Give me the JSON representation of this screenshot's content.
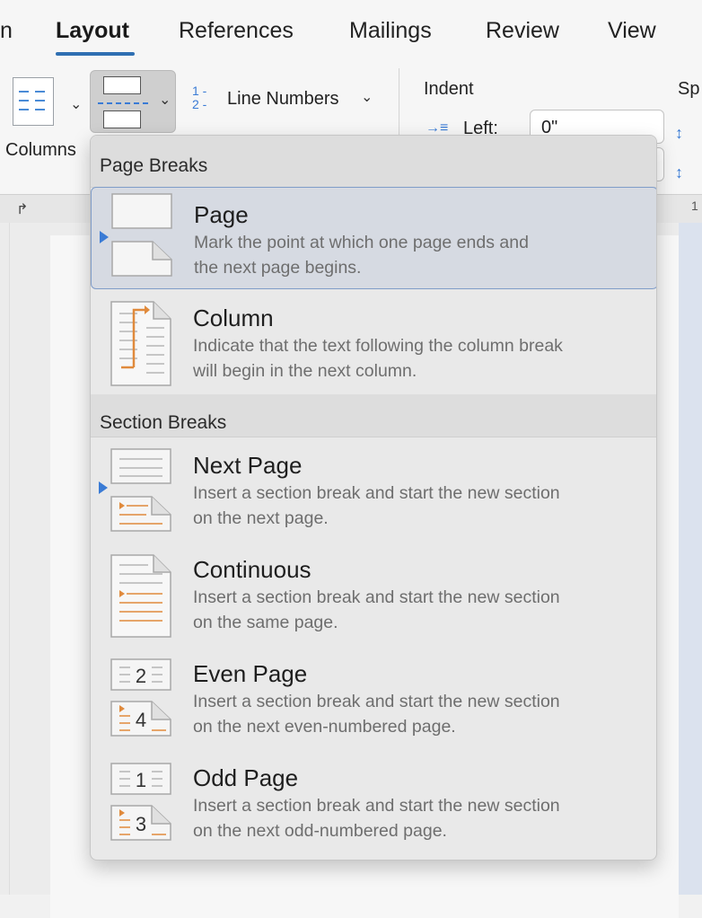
{
  "tabs": [
    {
      "label": "n",
      "active": false
    },
    {
      "label": "Layout",
      "active": true
    },
    {
      "label": "References",
      "active": false
    },
    {
      "label": "Mailings",
      "active": false
    },
    {
      "label": "Review",
      "active": false
    },
    {
      "label": "View",
      "active": false
    }
  ],
  "ribbon": {
    "columns_label": "Columns",
    "line_numbers_label": "Line Numbers",
    "line_numbers_digits": [
      "1",
      "2"
    ],
    "indent_label": "Indent",
    "left_label": "Left:",
    "left_value": "0\"",
    "spacing_label": "Sp"
  },
  "ruler": {
    "mark": "1"
  },
  "menu": {
    "page_breaks_header": "Page Breaks",
    "section_breaks_header": "Section Breaks",
    "page_breaks": [
      {
        "title": "Page",
        "desc_lines": [
          "Mark the point at which one page ends and",
          "the next page begins."
        ],
        "selected": true,
        "icon": "page-break-icon"
      },
      {
        "title": "Column",
        "desc_lines": [
          "Indicate that the text following the column break",
          "will begin in the next column."
        ],
        "selected": false,
        "icon": "column-break-icon"
      }
    ],
    "section_breaks": [
      {
        "title": "Next Page",
        "desc_lines": [
          "Insert a section break and start the new section",
          "on the next page."
        ],
        "icon": "next-page-icon"
      },
      {
        "title": "Continuous",
        "desc_lines": [
          "Insert a section break and start the new section",
          "on the same page."
        ],
        "icon": "continuous-icon"
      },
      {
        "title": "Even Page",
        "desc_lines": [
          "Insert a section break and start the new section",
          "on the next even-numbered page."
        ],
        "icon": "even-page-icon",
        "numbers": [
          "2",
          "4"
        ]
      },
      {
        "title": "Odd Page",
        "desc_lines": [
          "Insert a section break and start the new section",
          "on the next odd-numbered page."
        ],
        "icon": "odd-page-icon",
        "numbers": [
          "1",
          "3"
        ]
      }
    ]
  },
  "colors": {
    "accent": "#3a7bd5",
    "orange": "#e08a3c",
    "selected_bg": "#d6dae2",
    "selected_border": "#7f9cc8"
  }
}
